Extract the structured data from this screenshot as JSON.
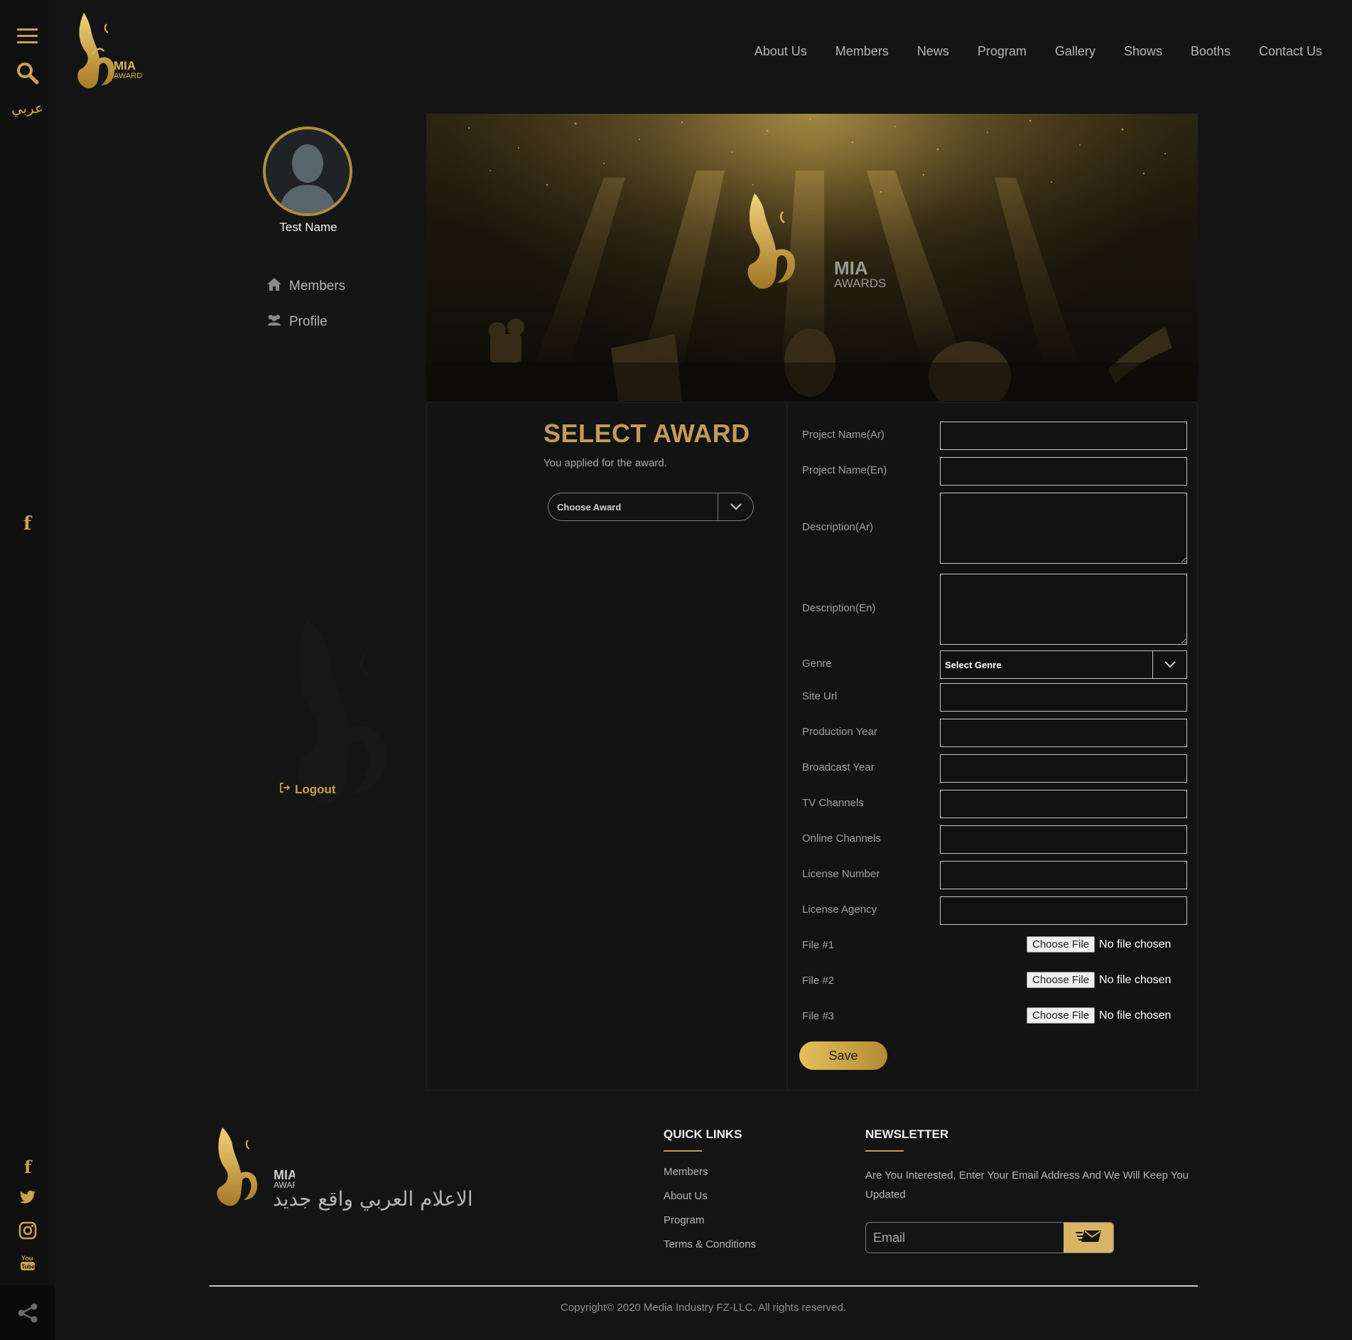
{
  "brand": {
    "logo_line1": "MIA",
    "logo_line2": "AWARD",
    "banner_line1": "MIA",
    "banner_line2": "AWARDS",
    "accent": "#c9a34f"
  },
  "rail": {
    "lang_label": "عربي"
  },
  "nav": {
    "items": [
      "About Us",
      "Members",
      "News",
      "Program",
      "Gallery",
      "Shows",
      "Booths",
      "Contact Us"
    ]
  },
  "sidebar": {
    "user_name": "Test Name",
    "items": [
      {
        "label": "Members",
        "icon": "home-icon"
      },
      {
        "label": "Profile",
        "icon": "users-icon"
      }
    ],
    "logout": "Logout"
  },
  "award": {
    "title": "SELECT AWARD",
    "subtitle": "You applied for the award.",
    "choose_placeholder": "Choose Award"
  },
  "form": {
    "project_name_ar": "Project Name(Ar)",
    "project_name_en": "Project Name(En)",
    "description_ar": "Description(Ar)",
    "description_en": "Description(En)",
    "genre": "Genre",
    "genre_select": "Select Genre",
    "site_url": "Site Url",
    "production_year": "Production Year",
    "broadcast_year": "Broadcast Year",
    "tv_channels": "TV Channels",
    "online_channels": "Online Channels",
    "license_number": "License Number",
    "license_agency": "License Agency",
    "file1": "File #1",
    "file2": "File #2",
    "file3": "File #3",
    "choose_file": "Choose File",
    "no_file": "No file chosen",
    "save": "Save"
  },
  "footer": {
    "logo_line1": "MIA",
    "logo_line2": "AWARD",
    "tagline_ar": "الاعلام العربي واقع جديد",
    "quick_links_title": "QUICK LINKS",
    "quick_links": [
      "Members",
      "About Us",
      "Program",
      "Terms & Conditions"
    ],
    "newsletter_title": "NEWSLETTER",
    "newsletter_text": "Are You Interested, Enter Your Email Address And We Will Keep You Updated",
    "email_placeholder": "Email",
    "copyright": "Copyright© 2020 Media Industry FZ-LLC. All rights reserved."
  }
}
